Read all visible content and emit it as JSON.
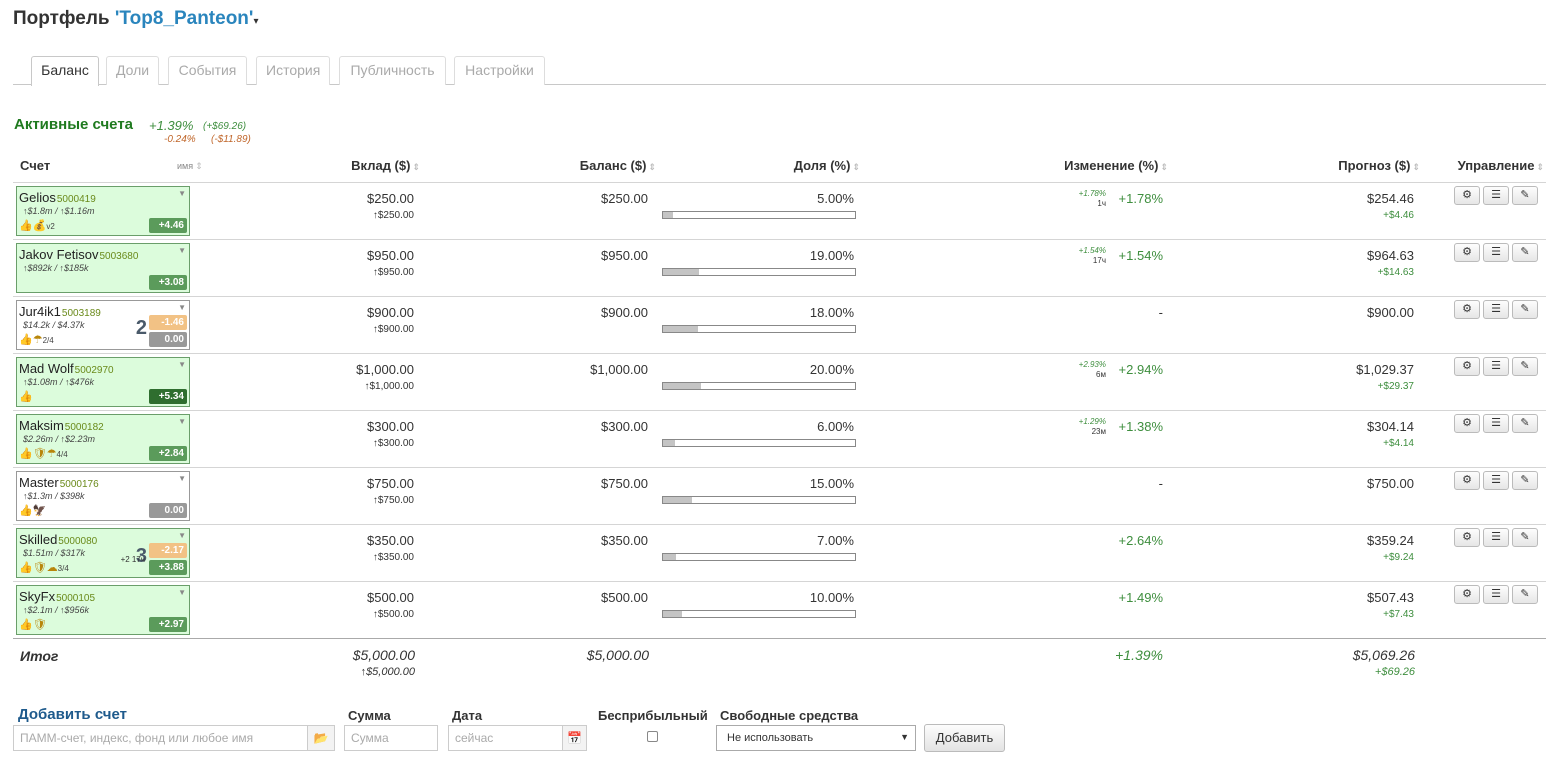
{
  "title": {
    "prefix": "Портфель",
    "name": "'Top8_Panteon'",
    "caret": "▾"
  },
  "tabs": [
    {
      "label": "Баланс",
      "active": true
    },
    {
      "label": "Доли",
      "active": false
    },
    {
      "label": "События",
      "active": false
    },
    {
      "label": "История",
      "active": false
    },
    {
      "label": "Публичность",
      "active": false
    },
    {
      "label": "Настройки",
      "active": false
    }
  ],
  "active_section": {
    "label": "Активные счета",
    "pct_pos": "+1.39%",
    "usd_pos": "(+$69.26)",
    "pct_neg": "-0.24%",
    "usd_neg": "(-$11.89)"
  },
  "columns": {
    "account": "Счет",
    "name_sort": "имя",
    "deposit": "Вклад ($)",
    "balance": "Баланс ($)",
    "share": "Доля (%)",
    "change": "Изменение (%)",
    "forecast": "Прогноз ($)",
    "manage": "Управление"
  },
  "sort_glyph": "⇕",
  "rows": [
    {
      "name": "Gelios",
      "id": "5000419",
      "sub": "↑$1.8m / ↑$1.16m",
      "icons": "👍💰",
      "icon_extra": "v2",
      "green": true,
      "badge_top": "",
      "badge": "+4.46",
      "badge_class": "b-green",
      "bignum": "",
      "side": "",
      "deposit": "$250.00",
      "deposit_sub": "↑$250.00",
      "balance": "$250.00",
      "share": "5.00%",
      "share_pct": 5,
      "chg_small": "+1.78%",
      "chg_time": "1ч",
      "change": "+1.78%",
      "forecast": "$254.46",
      "forecast_sub": "+$4.46"
    },
    {
      "name": "Jakov Fetisov",
      "id": "5003680",
      "sub": "↑$892k / ↑$185k",
      "icons": "",
      "icon_extra": "",
      "green": true,
      "badge_top": "",
      "badge": "+3.08",
      "badge_class": "b-green",
      "bignum": "",
      "side": "",
      "deposit": "$950.00",
      "deposit_sub": "↑$950.00",
      "balance": "$950.00",
      "share": "19.00%",
      "share_pct": 19,
      "chg_small": "+1.54%",
      "chg_time": "17ч",
      "change": "+1.54%",
      "forecast": "$964.63",
      "forecast_sub": "+$14.63"
    },
    {
      "name": "Jur4ik1",
      "id": "5003189",
      "sub": "$14.2k / $4.37k",
      "icons": "👍☂",
      "icon_extra": "2/4",
      "green": false,
      "badge_top": "-1.46",
      "badge": "0.00",
      "badge_class": "b-grey",
      "bignum": "2",
      "side": "",
      "deposit": "$900.00",
      "deposit_sub": "↑$900.00",
      "balance": "$900.00",
      "share": "18.00%",
      "share_pct": 18,
      "chg_small": "",
      "chg_time": "",
      "change": "-",
      "forecast": "$900.00",
      "forecast_sub": ""
    },
    {
      "name": "Mad Wolf",
      "id": "5002970",
      "sub": "↑$1.08m / ↑$476k",
      "icons": "👍",
      "icon_extra": "",
      "green": true,
      "badge_top": "",
      "badge": "+5.34",
      "badge_class": "b-dgreen",
      "bignum": "",
      "side": "",
      "deposit": "$1,000.00",
      "deposit_sub": "↑$1,000.00",
      "balance": "$1,000.00",
      "share": "20.00%",
      "share_pct": 20,
      "chg_small": "+2.93%",
      "chg_time": "6м",
      "change": "+2.94%",
      "forecast": "$1,029.37",
      "forecast_sub": "+$29.37"
    },
    {
      "name": "Maksim",
      "id": "5000182",
      "sub": "$2.26m / ↑$2.23m",
      "icons": "👍🛡☂",
      "icon_extra": "4/4",
      "green": true,
      "badge_top": "",
      "badge": "+2.84",
      "badge_class": "b-green",
      "bignum": "",
      "side": "",
      "deposit": "$300.00",
      "deposit_sub": "↑$300.00",
      "balance": "$300.00",
      "share": "6.00%",
      "share_pct": 6,
      "chg_small": "+1.29%",
      "chg_time": "23м",
      "change": "+1.38%",
      "forecast": "$304.14",
      "forecast_sub": "+$4.14"
    },
    {
      "name": "Master",
      "id": "5000176",
      "sub": "↑$1.3m / $398k",
      "icons": "👍🦅",
      "icon_extra": "",
      "green": false,
      "badge_top": "",
      "badge": "0.00",
      "badge_class": "b-grey",
      "bignum": "",
      "side": "",
      "deposit": "$750.00",
      "deposit_sub": "↑$750.00",
      "balance": "$750.00",
      "share": "15.00%",
      "share_pct": 15,
      "chg_small": "",
      "chg_time": "",
      "change": "-",
      "forecast": "$750.00",
      "forecast_sub": ""
    },
    {
      "name": "Skilled",
      "id": "5000080",
      "sub": "$1.51m / $317k",
      "icons": "👍🛡☁",
      "icon_extra": "3/4",
      "green": true,
      "badge_top": "-2.17",
      "badge": "+3.88",
      "badge_class": "b-green",
      "bignum": "3",
      "side": "+2 17ч",
      "deposit": "$350.00",
      "deposit_sub": "↑$350.00",
      "balance": "$350.00",
      "share": "7.00%",
      "share_pct": 7,
      "chg_small": "",
      "chg_time": "",
      "change": "+2.64%",
      "forecast": "$359.24",
      "forecast_sub": "+$9.24"
    },
    {
      "name": "SkyFx",
      "id": "5000105",
      "sub": "↑$2.1m / ↑$956k",
      "icons": "👍🛡",
      "icon_extra": "",
      "green": true,
      "badge_top": "",
      "badge": "+2.97",
      "badge_class": "b-green",
      "bignum": "",
      "side": "",
      "deposit": "$500.00",
      "deposit_sub": "↑$500.00",
      "balance": "$500.00",
      "share": "10.00%",
      "share_pct": 10,
      "chg_small": "",
      "chg_time": "",
      "change": "+1.49%",
      "forecast": "$507.43",
      "forecast_sub": "+$7.43"
    }
  ],
  "row_buttons": {
    "settings": "⚙",
    "list": "☰",
    "edit": "✎"
  },
  "total": {
    "label": "Итог",
    "deposit": "$5,000.00",
    "deposit_sub": "↑$5,000.00",
    "balance": "$5,000.00",
    "change": "+1.39%",
    "forecast": "$5,069.26",
    "forecast_sub": "+$69.26"
  },
  "add_form": {
    "title": "Добавить счет",
    "account_placeholder": "ПАММ-счет, индекс, фонд или любое имя",
    "folder_icon": "📂",
    "sum_label": "Сумма",
    "sum_placeholder": "Сумма",
    "date_label": "Дата",
    "date_placeholder": "сейчас",
    "calendar_icon": "📅",
    "noprofit_label": "Бесприбыльный",
    "free_funds_label": "Свободные средства",
    "free_funds_value": "Не использовать",
    "select_arrow": "▼",
    "add_button": "Добавить"
  },
  "colors": {
    "accent": "#2a85bd",
    "green": "#1f7a1f",
    "positive": "#3e8e3e",
    "negative": "#c0662a",
    "card_green": "#dcfcdc"
  }
}
